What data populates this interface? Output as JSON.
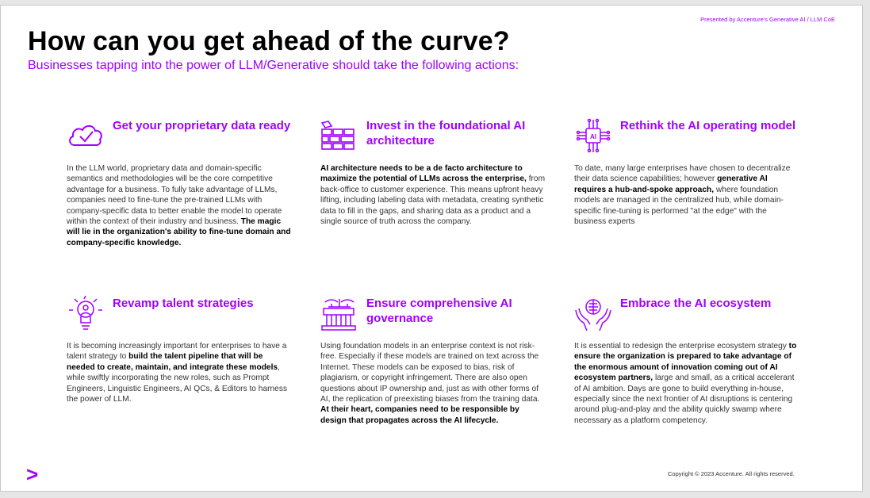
{
  "header": {
    "presented_by": "Presented by Accenture's Generative AI / LLM CoE",
    "title": "How can you get ahead of the curve?",
    "subtitle": "Businesses tapping into the power of LLM/Generative should take the following actions:"
  },
  "cards": [
    {
      "icon": "cloud-check-icon",
      "heading": "Get your proprietary data ready",
      "body_parts": [
        {
          "text": "In the LLM world, proprietary data and domain-specific semantics and methodologies will be the core competitive advantage for a business. To fully take advantage of LLMs, companies need to fine-tune the pre-trained LLMs with company-specific data to better enable the model to operate within the context of their industry and business. ",
          "bold": false
        },
        {
          "text": "The magic will lie in the organization's ability to fine-tune domain and company-specific knowledge.",
          "bold": true
        }
      ]
    },
    {
      "icon": "architecture-blocks-icon",
      "heading": "Invest in the foundational AI architecture",
      "body_parts": [
        {
          "text": "AI architecture needs to be a de facto architecture to maximize the potential of LLMs across the enterprise,",
          "bold": true
        },
        {
          "text": " from back-office to customer experience. This means upfront heavy lifting, including labeling data with metadata, creating synthetic data to fill in the gaps, and sharing data as a product and a single source of truth across the company.",
          "bold": false
        }
      ]
    },
    {
      "icon": "ai-chip-network-icon",
      "heading": "Rethink the AI operating model",
      "body_parts": [
        {
          "text": "To date, many large enterprises have chosen to decentralize their data science capabilities; however ",
          "bold": false
        },
        {
          "text": "generative AI requires a hub-and-spoke approach,",
          "bold": true
        },
        {
          "text": " where foundation models are managed in the centralized hub, while domain-specific fine-tuning is performed  \"at the edge\" with the business experts",
          "bold": false
        }
      ]
    },
    {
      "icon": "talent-lightbulb-icon",
      "heading": "Revamp talent strategies",
      "body_parts": [
        {
          "text": "It is becoming increasingly important for enterprises to have a talent strategy to ",
          "bold": false
        },
        {
          "text": "build the talent pipeline that will be needed to create, maintain, and integrate these models",
          "bold": true
        },
        {
          "text": ", while swiftly incorporating the new roles, such as Prompt Engineers, Linguistic Engineers, AI QCs, & Editors to harness the power of LLM.",
          "bold": false
        }
      ]
    },
    {
      "icon": "governance-building-icon",
      "heading": "Ensure comprehensive AI governance",
      "body_parts": [
        {
          "text": "Using foundation models in an enterprise context is not risk-free. Especially if these models are trained on text across the Internet. These models can be exposed to bias, risk of plagiarism, or copyright infringement. There are also open questions about IP ownership and, just as with other forms of AI, the replication of preexisting biases from the training data. ",
          "bold": false
        },
        {
          "text": "At their heart, companies need to be responsible by design that propagates across the AI lifecycle.",
          "bold": true
        }
      ]
    },
    {
      "icon": "hands-brain-ecosystem-icon",
      "heading": "Embrace the AI ecosystem",
      "body_parts": [
        {
          "text": "It is essential to redesign the enterprise ecosystem strategy ",
          "bold": false
        },
        {
          "text": "to ensure the organization is prepared to take advantage of the enormous amount of innovation coming out of AI ecosystem partners,",
          "bold": true
        },
        {
          "text": " large and small, as a critical accelerant of AI ambition. Days are gone to build everything in-house, especially since the next frontier of AI disruptions is centering around plug-and-play and the ability quickly swamp where necessary as a platform competency.",
          "bold": false
        }
      ]
    }
  ],
  "footer": {
    "logo": ">",
    "copyright": "Copyright © 2023 Accenture. All rights reserved."
  },
  "colors": {
    "accent": "#a100ff",
    "title": "#000000",
    "body": "#333333"
  }
}
